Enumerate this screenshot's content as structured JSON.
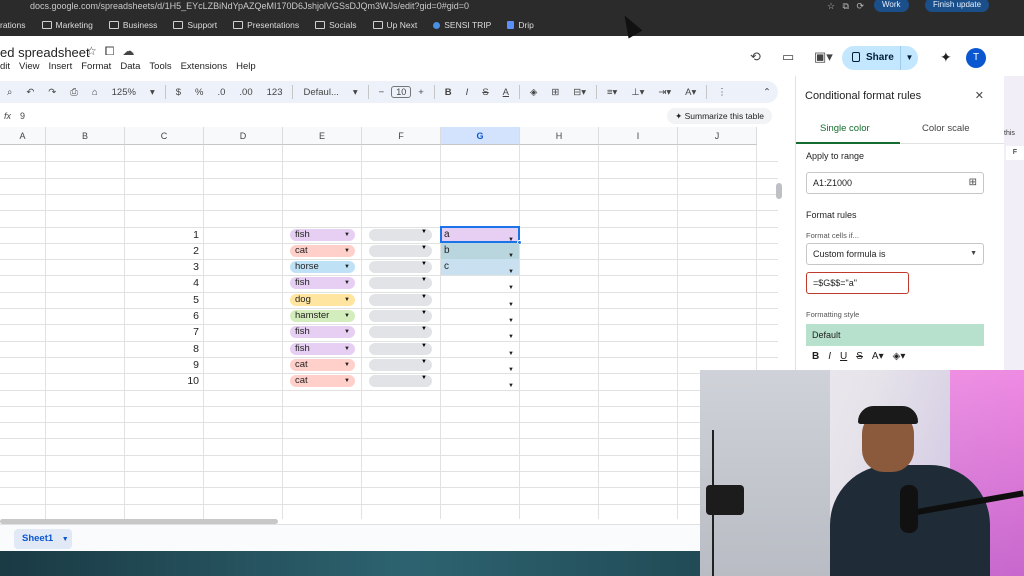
{
  "browser": {
    "url": "docs.google.com/spreadsheets/d/1H5_EYcLZBiNdYpAZQeMI170D6JshjolVGSsDJQm3WJs/edit?gid=0#gid=0",
    "profile_label": "Work",
    "update_label": "Finish update",
    "bookmarks": [
      {
        "label": "rations",
        "icon": "folder-icon"
      },
      {
        "label": "Marketing",
        "icon": "folder-icon"
      },
      {
        "label": "Business",
        "icon": "folder-icon"
      },
      {
        "label": "Support",
        "icon": "folder-icon"
      },
      {
        "label": "Presentations",
        "icon": "folder-icon"
      },
      {
        "label": "Socials",
        "icon": "folder-icon"
      },
      {
        "label": "Up Next",
        "icon": "folder-icon"
      },
      {
        "label": "SENSI TRIP",
        "icon": "globe-icon"
      },
      {
        "label": "Drip",
        "icon": "doc-icon"
      }
    ]
  },
  "sheets": {
    "title": "ed spreadsheet",
    "menu": [
      "dit",
      "View",
      "Insert",
      "Format",
      "Data",
      "Tools",
      "Extensions",
      "Help"
    ],
    "share_label": "Share",
    "avatar_letter": "T",
    "toolbar": {
      "zoom": "125%",
      "currency": "$",
      "percent": "%",
      "dec_down": ".0",
      "dec_up": ".00",
      "number_fmt": "123",
      "font": "Defaul...",
      "font_size": "10"
    },
    "cell_ref": "9",
    "fx_label": "fx",
    "summarize_label": "Summarize this table",
    "columns": [
      "A",
      "B",
      "C",
      "D",
      "E",
      "F",
      "G",
      "H",
      "I",
      "J"
    ],
    "selected_column": "G",
    "rows": [
      {
        "n": "1",
        "animal": "fish",
        "g": "a"
      },
      {
        "n": "2",
        "animal": "cat",
        "g": "b"
      },
      {
        "n": "3",
        "animal": "horse",
        "g": "c"
      },
      {
        "n": "4",
        "animal": "fish",
        "g": ""
      },
      {
        "n": "5",
        "animal": "dog",
        "g": ""
      },
      {
        "n": "6",
        "animal": "hamster",
        "g": ""
      },
      {
        "n": "7",
        "animal": "fish",
        "g": ""
      },
      {
        "n": "8",
        "animal": "fish",
        "g": ""
      },
      {
        "n": "9",
        "animal": "cat",
        "g": ""
      },
      {
        "n": "10",
        "animal": "cat",
        "g": ""
      }
    ],
    "chip_colors": {
      "fish": "#e6cff2",
      "cat": "#ffcfc9",
      "horse": "#bfe1f6",
      "dog": "#ffe5a0",
      "hamster": "#d4edbc"
    },
    "g_colors": {
      "a": "#e6cff2",
      "b": "#b9d6df",
      "c": "#c9e0f0"
    },
    "sheet_tab": "Sheet1"
  },
  "panel": {
    "title": "Conditional format rules",
    "tab_single": "Single color",
    "tab_scale": "Color scale",
    "apply_label": "Apply to range",
    "range": "A1:Z1000",
    "rules_label": "Format rules",
    "cells_if_label": "Format cells if...",
    "condition": "Custom formula is",
    "formula": "=$G$$=\"a\"",
    "style_label": "Formatting style",
    "style_default": "Default",
    "format_buttons": [
      "B",
      "I",
      "U",
      "S",
      "A"
    ],
    "accent": "#146c2e"
  },
  "strip": {
    "label": "this",
    "cell": "F"
  }
}
